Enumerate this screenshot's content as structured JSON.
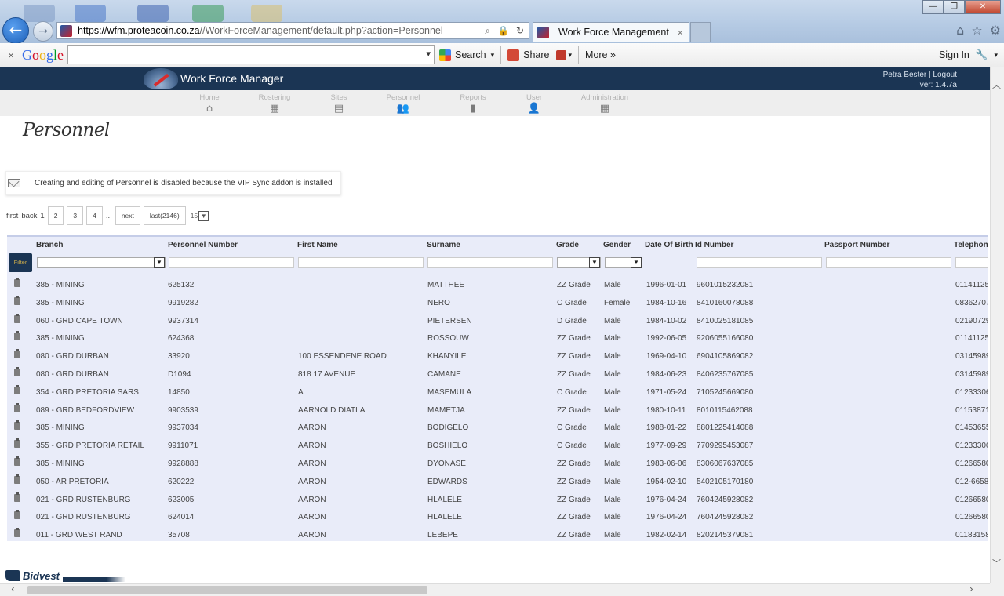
{
  "browser": {
    "url_domain": "https://wfm.proteacoin.co.za",
    "url_path": "//WorkForceManagement/default.php?action=Personnel",
    "tab_title": "Work Force Management",
    "minimize": "—",
    "maximize": "❐",
    "close": "✕"
  },
  "google_toolbar": {
    "close": "×",
    "logo": "Google",
    "search_value": "",
    "search_label": "Search",
    "share_label": "Share",
    "more_label": "More »",
    "signin_label": "Sign In"
  },
  "app": {
    "title": "Work Force Manager",
    "user": "Petra Bester",
    "logout": "Logout",
    "version": "ver: 1.4.7a"
  },
  "nav": [
    {
      "label": "Home",
      "icon": "home-icon",
      "glyph": "⌂"
    },
    {
      "label": "Rostering",
      "icon": "calendar-icon",
      "glyph": "▦"
    },
    {
      "label": "Sites",
      "icon": "document-icon",
      "glyph": "▤"
    },
    {
      "label": "Personnel",
      "icon": "people-icon",
      "glyph": "👥"
    },
    {
      "label": "Reports",
      "icon": "clipboard-icon",
      "glyph": "▮"
    },
    {
      "label": "User",
      "icon": "user-icon",
      "glyph": "👤"
    },
    {
      "label": "Administration",
      "icon": "grid-icon",
      "glyph": "▦"
    }
  ],
  "page": {
    "title": "Personnel",
    "notice": "Creating and editing of Personnel is disabled because the VIP Sync addon is installed"
  },
  "pager": {
    "first": "first",
    "back": "back",
    "current": "1",
    "pages": [
      "2",
      "3",
      "4"
    ],
    "ellipsis": "...",
    "next": "next",
    "last": "last(2146)",
    "page_size": "15"
  },
  "table": {
    "filter_label": "Filter",
    "columns": [
      "Branch",
      "Personnel Number",
      "First Name",
      "Surname",
      "Grade",
      "Gender",
      "Date Of Birth",
      "Id Number",
      "Passport Number",
      "Telephone"
    ],
    "rows": [
      [
        "385 - MINING",
        "625132",
        "",
        "MATTHEE",
        "ZZ Grade",
        "Male",
        "1996-01-01",
        "9601015232081",
        "",
        "01141125"
      ],
      [
        "385 - MINING",
        "9919282",
        "",
        "NERO",
        "C Grade",
        "Female",
        "1984-10-16",
        "8410160078088",
        "",
        "08362707"
      ],
      [
        "060 - GRD CAPE TOWN",
        "9937314",
        "",
        "PIETERSEN",
        "D Grade",
        "Male",
        "1984-10-02",
        "8410025181085",
        "",
        "02190729"
      ],
      [
        "385 - MINING",
        "624368",
        "",
        "ROSSOUW",
        "ZZ Grade",
        "Male",
        "1992-06-05",
        "9206055166080",
        "",
        "01141125"
      ],
      [
        "080 - GRD DURBAN",
        "33920",
        "100 ESSENDENE ROAD",
        "KHANYILE",
        "ZZ Grade",
        "Male",
        "1969-04-10",
        "6904105869082",
        "",
        "03145989"
      ],
      [
        "080 - GRD DURBAN",
        "D1094",
        "818 17 AVENUE",
        "CAMANE",
        "ZZ Grade",
        "Male",
        "1984-06-23",
        "8406235767085",
        "",
        "03145989"
      ],
      [
        "354 - GRD PRETORIA SARS",
        "14850",
        "A",
        "MASEMULA",
        "C Grade",
        "Male",
        "1971-05-24",
        "7105245669080",
        "",
        "01233306"
      ],
      [
        "089 - GRD BEDFORDVIEW",
        "9903539",
        "AARNOLD DIATLA",
        "MAMETJA",
        "ZZ Grade",
        "Male",
        "1980-10-11",
        "8010115462088",
        "",
        "01153871"
      ],
      [
        "385 - MINING",
        "9937034",
        "AARON",
        "BODIGELO",
        "C Grade",
        "Male",
        "1988-01-22",
        "8801225414088",
        "",
        "01453655"
      ],
      [
        "355 - GRD PRETORIA RETAIL",
        "9911071",
        "AARON",
        "BOSHIELO",
        "C Grade",
        "Male",
        "1977-09-29",
        "7709295453087",
        "",
        "01233306"
      ],
      [
        "385 - MINING",
        "9928888",
        "AARON",
        "DYONASE",
        "ZZ Grade",
        "Male",
        "1983-06-06",
        "8306067637085",
        "",
        "01266580"
      ],
      [
        "050 - AR PRETORIA",
        "620222",
        "AARON",
        "EDWARDS",
        "ZZ Grade",
        "Male",
        "1954-02-10",
        "5402105170180",
        "",
        "012-6658"
      ],
      [
        "021 - GRD RUSTENBURG",
        "623005",
        "AARON",
        "HLALELE",
        "ZZ Grade",
        "Male",
        "1976-04-24",
        "7604245928082",
        "",
        "01266580"
      ],
      [
        "021 - GRD RUSTENBURG",
        "624014",
        "AARON",
        "HLALELE",
        "ZZ Grade",
        "Male",
        "1976-04-24",
        "7604245928082",
        "",
        "01266580"
      ],
      [
        "011 - GRD WEST RAND",
        "35708",
        "AARON",
        "LEBEPE",
        "ZZ Grade",
        "Male",
        "1982-02-14",
        "8202145379081",
        "",
        "01183158"
      ]
    ]
  },
  "footer": {
    "logo": "Bidvest"
  }
}
